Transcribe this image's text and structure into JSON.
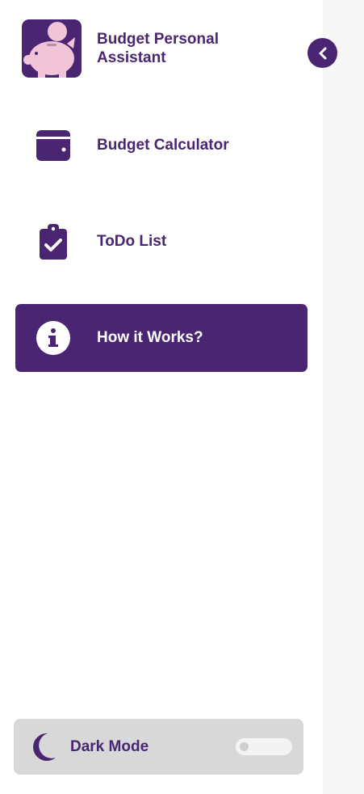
{
  "brand": {
    "title": "Budget Personal Assistant",
    "logo_icon": "piggy-bank-icon"
  },
  "collapse_button": {
    "icon": "chevron-left-icon"
  },
  "nav": {
    "items": [
      {
        "label": "Budget Calculator",
        "icon": "wallet-icon",
        "active": false
      },
      {
        "label": "ToDo List",
        "icon": "clipboard-check-icon",
        "active": false
      },
      {
        "label": "How it Works?",
        "icon": "info-icon",
        "active": true
      }
    ]
  },
  "dark_mode": {
    "label": "Dark Mode",
    "icon": "moon-icon",
    "enabled": false
  },
  "colors": {
    "primary": "#4a2672",
    "sidebar_bg": "#ffffff",
    "page_bg": "#f7f7f7",
    "dark_mode_panel": "#d8d8d8",
    "logo_accent": "#f2c4d8"
  }
}
